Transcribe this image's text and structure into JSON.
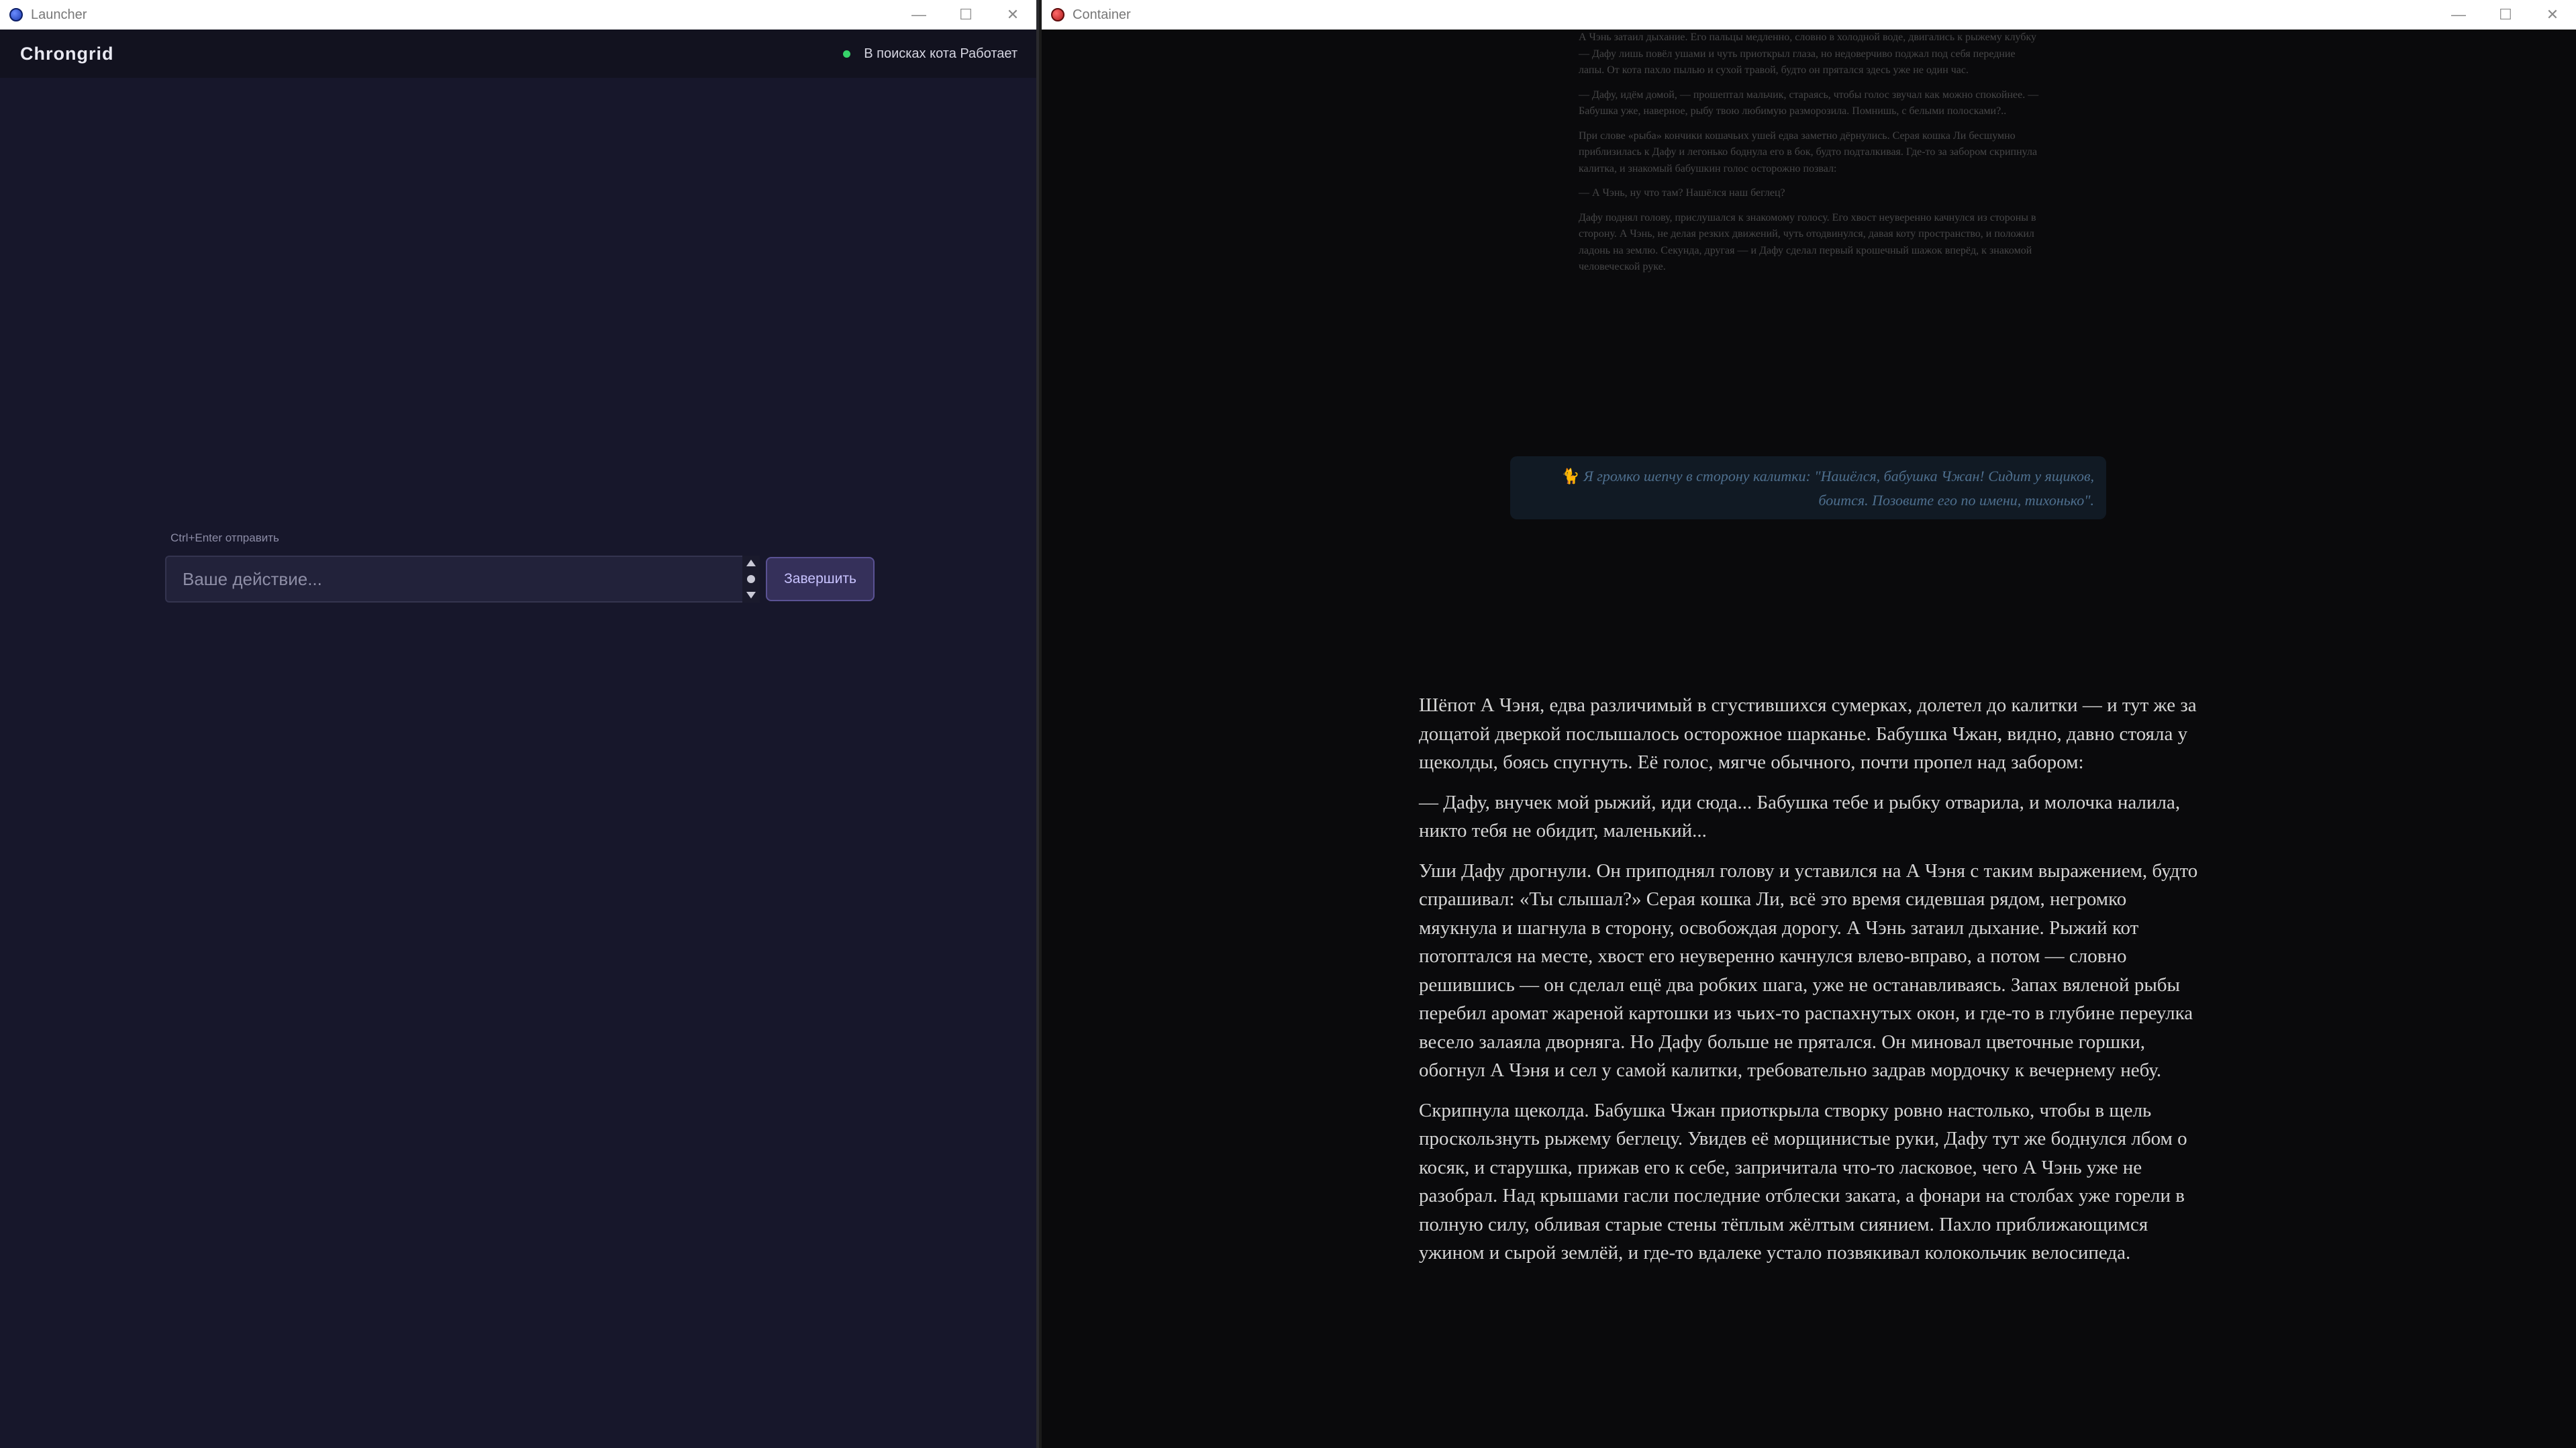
{
  "launcher_window": {
    "title": "Launcher",
    "controls": {
      "minimize": "—",
      "maximize": "☐",
      "close": "✕"
    },
    "app": {
      "brand": "Chrongrid",
      "status_text": "В поисках кота Работает",
      "status_color": "#37d36a",
      "hint": "Ctrl+Enter отправить",
      "input_placeholder": "Ваше действие...",
      "input_value": "",
      "finish_button": "Завершить"
    }
  },
  "container_window": {
    "title": "Container",
    "controls": {
      "minimize": "—",
      "maximize": "☐",
      "close": "✕"
    },
    "faded_paragraphs": [
      "А Чэнь затаил дыхание. Его пальцы медленно, словно в холодной воде, двигались к рыжему клубку — Дафу лишь повёл ушами и чуть приоткрыл глаза, но недоверчиво поджал под себя передние лапы. От кота пахло пылью и сухой травой, будто он прятался здесь уже не один час.",
      "— Дафу, идём домой, — прошептал мальчик, стараясь, чтобы голос звучал как можно спокойнее. — Бабушка уже, наверное, рыбу твою любимую разморозила. Помнишь, с белыми полосками?..",
      "При слове «рыба» кончики кошачьих ушей едва заметно дёрнулись. Серая кошка Ли бесшумно приблизилась к Дафу и легонько боднула его в бок, будто подталкивая. Где-то за забором скрипнула калитка, и знакомый бабушкин голос осторожно позвал:",
      "— А Чэнь, ну что там? Нашёлся наш беглец?",
      "Дафу поднял голову, прислушался к знакомому голосу. Его хвост неуверенно качнулся из стороны в сторону. А Чэнь, не делая резких движений, чуть отодвинулся, давая коту пространство, и положил ладонь на землю. Секунда, другая — и Дафу сделал первый крошечный шажок вперёд, к знакомой человеческой руке."
    ],
    "quote": {
      "icon": "🐈",
      "text": "Я громко шепчу в сторону калитки: \"Нашёлся, бабушка Чжан! Сидит у ящиков, боится. Позовите его по имени, тихонько\"."
    },
    "story_paragraphs": [
      "Шёпот А Чэня, едва различимый в сгустившихся сумерках, долетел до калитки — и тут же за дощатой дверкой послышалось осторожное шарканье. Бабушка Чжан, видно, давно стояла у щеколды, боясь спугнуть. Её голос, мягче обычного, почти пропел над забором:",
      "— Дафу, внучек мой рыжий, иди сюда... Бабушка тебе и рыбку отварила, и молочка налила, никто тебя не обидит, маленький...",
      "Уши Дафу дрогнули. Он приподнял голову и уставился на А Чэня с таким выражением, будто спрашивал: «Ты слышал?» Серая кошка Ли, всё это время сидевшая рядом, негромко мяукнула и шагнула в сторону, освобождая дорогу. А Чэнь затаил дыхание. Рыжий кот потоптался на месте, хвост его неуверенно качнулся влево-вправо, а потом — словно решившись — он сделал ещё два робких шага, уже не останавливаясь. Запах вяленой рыбы перебил аромат жареной картошки из чьих-то распахнутых окон, и где-то в глубине переулка весело залаяла дворняга. Но Дафу больше не прятался. Он миновал цветочные горшки, обогнул А Чэня и сел у самой калитки, требовательно задрав мордочку к вечернему небу.",
      "Скрипнула щеколда. Бабушка Чжан приоткрыла створку ровно настолько, чтобы в щель проскользнуть рыжему беглецу. Увидев её морщинистые руки, Дафу тут же боднулся лбом о косяк, и старушка, прижав его к себе, запричитала что-то ласковое, чего А Чэнь уже не разобрал. Над крышами гасли последние отблески заката, а фонари на столбах уже горели в полную силу, обливая старые стены тёплым жёлтым сиянием. Пахло приближающимся ужином и сырой землёй, и где-то вдалеке устало позвякивал колокольчик велосипеда."
    ]
  }
}
